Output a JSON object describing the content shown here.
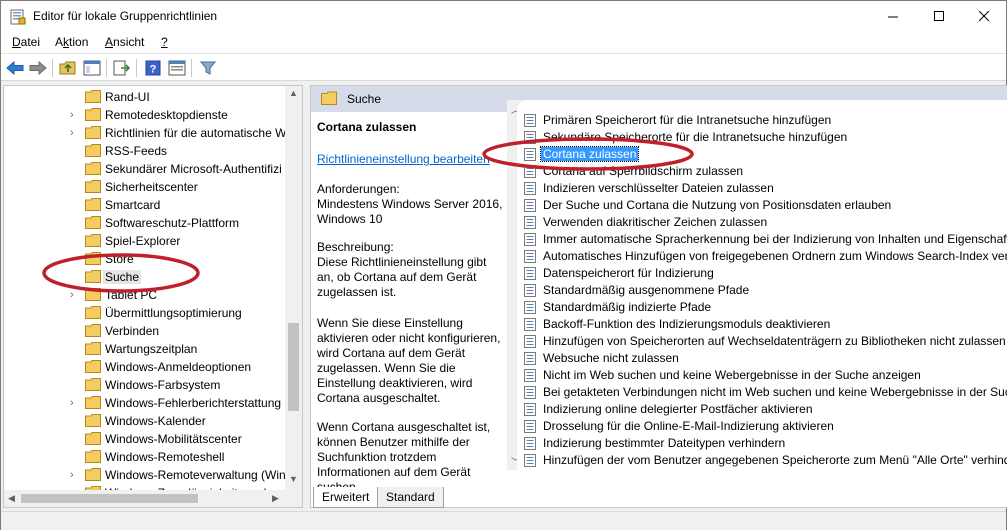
{
  "window": {
    "title": "Editor für lokale Gruppenrichtlinien"
  },
  "menu": {
    "items": [
      {
        "label": "Datei",
        "underline": "D"
      },
      {
        "label": "Aktion",
        "underline": "k"
      },
      {
        "label": "Ansicht",
        "underline": "A"
      },
      {
        "label": "?",
        "underline": "?"
      }
    ]
  },
  "toolbar": {
    "icons": [
      "back-arrow-icon",
      "forward-arrow-icon",
      "up-folder-icon",
      "show-hide-tree-icon",
      "export-list-icon",
      "help-icon",
      "properties-icon",
      "filter-icon"
    ]
  },
  "tree": {
    "items": [
      {
        "label": "Rand-UI",
        "expandable": false
      },
      {
        "label": "Remotedesktopdienste",
        "expandable": true
      },
      {
        "label": "Richtlinien für die automatische W",
        "expandable": true
      },
      {
        "label": "RSS-Feeds",
        "expandable": false
      },
      {
        "label": "Sekundärer Microsoft-Authentifizi",
        "expandable": false
      },
      {
        "label": "Sicherheitscenter",
        "expandable": false
      },
      {
        "label": "Smartcard",
        "expandable": false
      },
      {
        "label": "Softwareschutz-Plattform",
        "expandable": false
      },
      {
        "label": "Spiel-Explorer",
        "expandable": false
      },
      {
        "label": "Store",
        "expandable": false
      },
      {
        "label": "Suche",
        "expandable": false,
        "selected": true
      },
      {
        "label": "Tablet PC",
        "expandable": true
      },
      {
        "label": "Übermittlungsoptimierung",
        "expandable": false
      },
      {
        "label": "Verbinden",
        "expandable": false
      },
      {
        "label": "Wartungszeitplan",
        "expandable": false
      },
      {
        "label": "Windows-Anmeldeoptionen",
        "expandable": false
      },
      {
        "label": "Windows-Farbsystem",
        "expandable": false
      },
      {
        "label": "Windows-Fehlerberichterstattung",
        "expandable": true
      },
      {
        "label": "Windows-Kalender",
        "expandable": false
      },
      {
        "label": "Windows-Mobilitätscenter",
        "expandable": false
      },
      {
        "label": "Windows-Remoteshell",
        "expandable": false
      },
      {
        "label": "Windows-Remoteverwaltung (Win",
        "expandable": true
      },
      {
        "label": "Windows-Zuverlässigkeitsanalyse",
        "expandable": false
      }
    ]
  },
  "main": {
    "header": "Suche",
    "description": {
      "title": "Cortana zulassen",
      "edit_link": "Richtlinieneinstellung bearbeiten",
      "requirements": "Anforderungen:\nMindestens Windows Server 2016, Windows 10",
      "desc_heading": "Beschreibung:",
      "desc_p1": "Diese Richtlinieneinstellung gibt an, ob Cortana auf dem Gerät zugelassen ist.",
      "desc_p2": "Wenn Sie diese Einstellung aktivieren oder nicht konfigurieren, wird Cortana auf dem Gerät zugelassen. Wenn Sie die Einstellung deaktivieren, wird Cortana ausgeschaltet.",
      "desc_p3": "Wenn Cortana ausgeschaltet ist, können Benutzer mithilfe der Suchfunktion trotzdem Informationen auf dem Gerät suchen."
    },
    "policies": [
      "Primären Speicherort für die Intranetsuche hinzufügen",
      "Sekundäre Speicherorte für die Intranetsuche hinzufügen",
      "Cortana zulassen",
      "Cortana auf Sperrbildschirm zulassen",
      "Indizieren verschlüsselter Dateien zulassen",
      "Der Suche und Cortana die Nutzung von Positionsdaten erlauben",
      "Verwenden diakritischer Zeichen zulassen",
      "Immer automatische Spracherkennung bei der Indizierung von Inhalten und Eigenschaften verwenden",
      "Automatisches Hinzufügen von freigegebenen Ordnern zum Windows Search-Index verhindern",
      "Datenspeicherort für Indizierung",
      "Standardmäßig ausgenommene Pfade",
      "Standardmäßig indizierte Pfade",
      "Backoff-Funktion des Indizierungsmoduls deaktivieren",
      "Hinzufügen von Speicherorten auf Wechseldatenträgern zu Bibliotheken nicht zulassen",
      "Websuche nicht zulassen",
      "Nicht im Web suchen und keine Webergebnisse in der Suche anzeigen",
      "Bei getakteten Verbindungen nicht im Web suchen und keine Webergebnisse in der Suche anzeigen",
      "Indizierung online delegierter Postfächer aktivieren",
      "Drosselung für die Online-E-Mail-Indizierung aktivieren",
      "Indizierung bestimmter Dateitypen verhindern",
      "Hinzufügen der vom Benutzer angegebenen Speicherorte zum Menü \"Alle Orte\" verhindern"
    ],
    "selected_policy_index": 2
  },
  "tabs": [
    {
      "label": "Erweitert",
      "active": true
    },
    {
      "label": "Standard",
      "active": false
    }
  ],
  "colors": {
    "selection": "#3399ff",
    "annotation": "#c0202a",
    "header_band": "#d6dbe9",
    "link": "#0066cc"
  }
}
